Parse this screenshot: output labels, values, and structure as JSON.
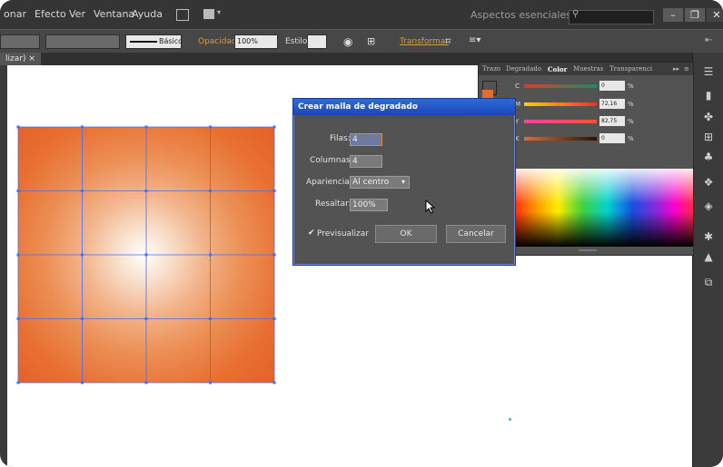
{
  "menubar": {
    "items": [
      "onar",
      "Efecto",
      "Ver",
      "Ventana",
      "Ayuda"
    ],
    "workspace": "Aspectos esenciales",
    "window_controls": [
      "–",
      "❐",
      "✕"
    ]
  },
  "controlbar": {
    "stroke_style": "Básico",
    "opacity_label": "Opacidad:",
    "opacity_value": "100%",
    "style_label": "Estilo:",
    "transform_label": "Transformar"
  },
  "document_tab": {
    "label": "lizar) ×"
  },
  "color_panel": {
    "tabs": [
      "Trazo",
      "Degradado",
      "Color",
      "Muestras",
      "Transparenci"
    ],
    "channels": [
      {
        "name": "C",
        "value": "0",
        "unit": "%"
      },
      {
        "name": "M",
        "value": "72,16",
        "unit": "%"
      },
      {
        "name": "Y",
        "value": "82,75",
        "unit": "%"
      },
      {
        "name": "K",
        "value": "0",
        "unit": "%"
      }
    ],
    "swatch_color": "#e86a30"
  },
  "dialog": {
    "title": "Crear malla de degradado",
    "rows_label": "Filas:",
    "rows_value": "4",
    "cols_label": "Columnas:",
    "cols_value": "4",
    "appearance_label": "Apariencia:",
    "appearance_value": "Al centro",
    "highlight_label": "Resaltar:",
    "highlight_value": "100%",
    "preview_label": "Previsualizar",
    "preview_checked": true,
    "ok_label": "OK",
    "cancel_label": "Cancelar"
  },
  "mesh": {
    "rows": 4,
    "columns": 4,
    "edge_color": "#e4622a",
    "center_color": "#ffffff",
    "grid_color": "#4a6cf0"
  }
}
